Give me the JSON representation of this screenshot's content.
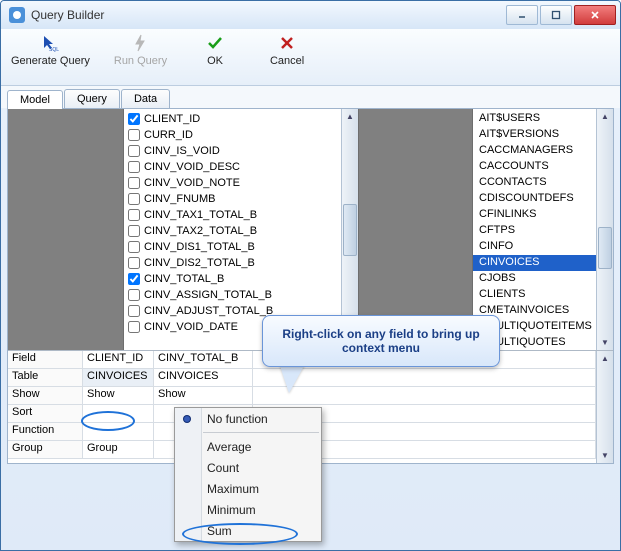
{
  "window": {
    "title": "Query Builder"
  },
  "toolbar": {
    "generate": "Generate Query",
    "run": "Run Query",
    "ok": "OK",
    "cancel": "Cancel"
  },
  "tabs": {
    "model": "Model",
    "query": "Query",
    "data": "Data"
  },
  "fields": [
    {
      "name": "CLIENT_ID",
      "checked": true
    },
    {
      "name": "CURR_ID",
      "checked": false
    },
    {
      "name": "CINV_IS_VOID",
      "checked": false
    },
    {
      "name": "CINV_VOID_DESC",
      "checked": false
    },
    {
      "name": "CINV_VOID_NOTE",
      "checked": false
    },
    {
      "name": "CINV_FNUMB",
      "checked": false
    },
    {
      "name": "CINV_TAX1_TOTAL_B",
      "checked": false
    },
    {
      "name": "CINV_TAX2_TOTAL_B",
      "checked": false
    },
    {
      "name": "CINV_DIS1_TOTAL_B",
      "checked": false
    },
    {
      "name": "CINV_DIS2_TOTAL_B",
      "checked": false
    },
    {
      "name": "CINV_TOTAL_B",
      "checked": true
    },
    {
      "name": "CINV_ASSIGN_TOTAL_B",
      "checked": false
    },
    {
      "name": "CINV_ADJUST_TOTAL_B",
      "checked": false
    },
    {
      "name": "CINV_VOID_DATE",
      "checked": false
    }
  ],
  "tables": [
    {
      "name": "AIT$USERS"
    },
    {
      "name": "AIT$VERSIONS"
    },
    {
      "name": "CACCMANAGERS"
    },
    {
      "name": "CACCOUNTS"
    },
    {
      "name": "CCONTACTS"
    },
    {
      "name": "CDISCOUNTDEFS"
    },
    {
      "name": "CFINLINKS"
    },
    {
      "name": "CFTPS"
    },
    {
      "name": "CINFO"
    },
    {
      "name": "CINVOICES",
      "selected": true
    },
    {
      "name": "CJOBS"
    },
    {
      "name": "CLIENTS"
    },
    {
      "name": "CMETAINVOICES"
    },
    {
      "name": "CMULTIQUOTEITEMS"
    },
    {
      "name": "CMULTIQUOTES"
    }
  ],
  "grid": {
    "rows": [
      "Field",
      "Table",
      "Show",
      "Sort",
      "Function",
      "Group"
    ],
    "cols": [
      {
        "Field": "CLIENT_ID",
        "Table": "CINVOICES",
        "Show": "Show",
        "Sort": "",
        "Function": "",
        "Group": "Group"
      },
      {
        "Field": "CINV_TOTAL_B",
        "Table": "CINVOICES",
        "Show": "Show",
        "Sort": "",
        "Function": "",
        "Group": ""
      }
    ]
  },
  "contextmenu": {
    "items": [
      "No function",
      "Average",
      "Count",
      "Maximum",
      "Minimum",
      "Sum"
    ],
    "selected": "No function"
  },
  "callout": "Right-click on any field to bring up context menu"
}
